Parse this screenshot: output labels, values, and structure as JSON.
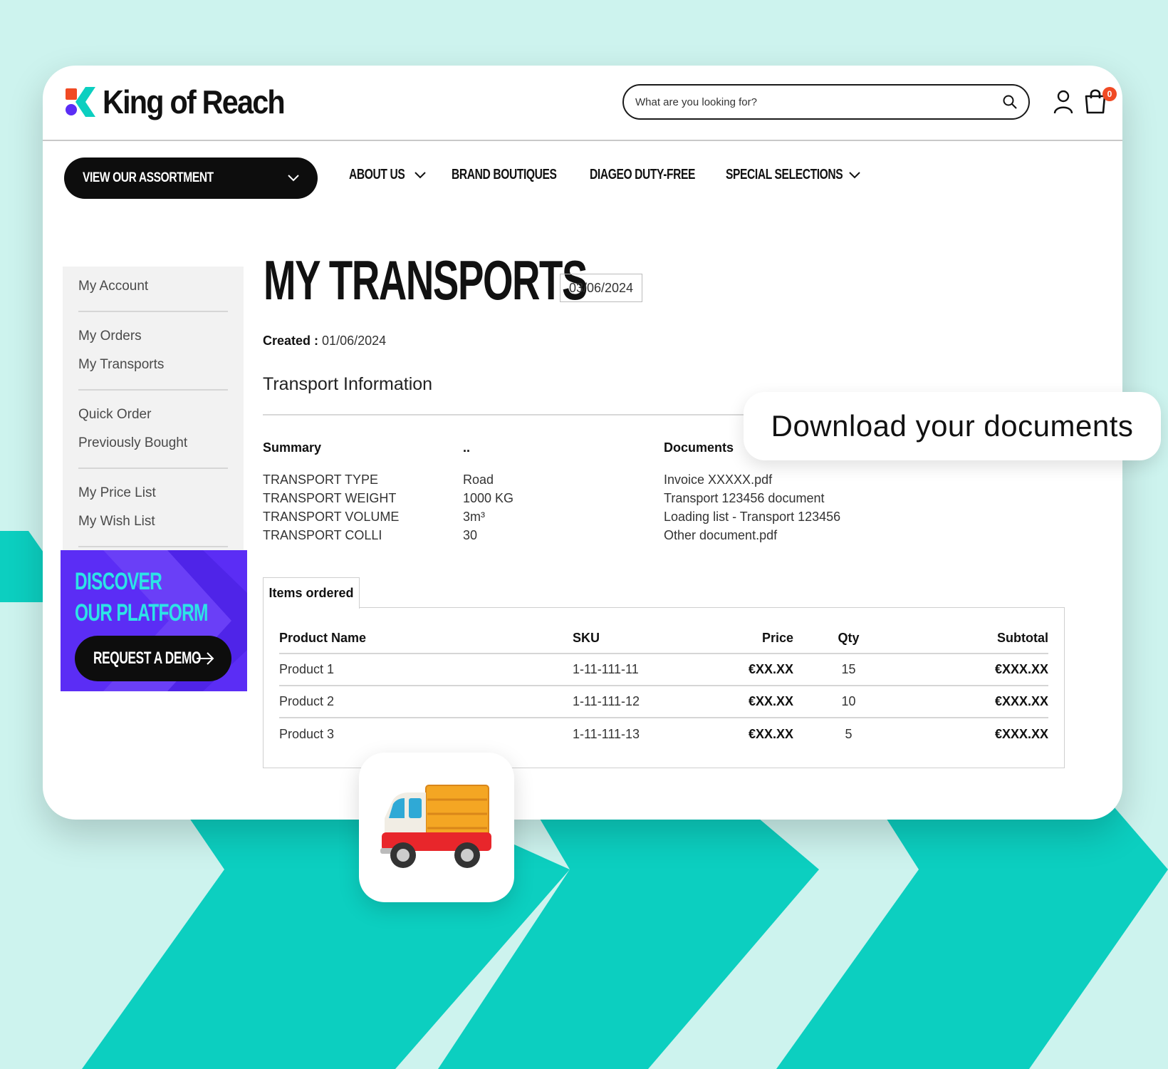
{
  "brand": {
    "name": "King of Reach",
    "colors": {
      "accent_teal": "#0ccfc0",
      "accent_purple": "#5b2df5",
      "accent_orange": "#f04a24",
      "dark": "#0d0d0d"
    }
  },
  "header": {
    "search_placeholder": "What are you looking for?",
    "icons": [
      "search-icon",
      "user-icon",
      "cart-icon"
    ],
    "cart_count": "0"
  },
  "nav": {
    "assortment_label": "VIEW OUR ASSORTMENT",
    "items": [
      {
        "label": "ABOUT US",
        "dropdown": true
      },
      {
        "label": "BRAND BOUTIQUES",
        "dropdown": false
      },
      {
        "label": "DIAGEO DUTY-FREE",
        "dropdown": false
      },
      {
        "label": "SPECIAL SELECTIONS",
        "dropdown": true
      }
    ]
  },
  "sidebar": {
    "groups": [
      [
        "My Account"
      ],
      [
        "My Orders",
        "My Transports"
      ],
      [
        "Quick Order",
        "Previously Bought"
      ],
      [
        "My Price List",
        "My Wish List"
      ]
    ],
    "promo": {
      "line1": "DISCOVER",
      "line2": "OUR PLATFORM",
      "button": "REQUEST A DEMO"
    }
  },
  "page": {
    "title": "MY TRANSPORTS",
    "date": "03/06/2024",
    "created_label": "Created :",
    "created_value": "01/06/2024",
    "section_title": "Transport Information"
  },
  "summary": {
    "heading": "Summary",
    "value_heading": "..",
    "rows": [
      {
        "label": "TRANSPORT TYPE",
        "value": "Road"
      },
      {
        "label": "TRANSPORT WEIGHT",
        "value": "1000 KG"
      },
      {
        "label": "TRANSPORT VOLUME",
        "value": "3m³"
      },
      {
        "label": "TRANSPORT COLLI",
        "value": "30"
      }
    ]
  },
  "documents": {
    "heading": "Documents",
    "items": [
      "Invoice XXXXX.pdf",
      "Transport 123456 document",
      "Loading list - Transport 123456",
      "Other document.pdf"
    ]
  },
  "items_ordered": {
    "tab_label": "Items ordered",
    "columns": [
      "Product Name",
      "SKU",
      "Price",
      "Qty",
      "Subtotal"
    ],
    "rows": [
      [
        "Product 1",
        "1-11-111-11",
        "€XX.XX",
        "15",
        "€XXX.XX"
      ],
      [
        "Product 2",
        "1-11-111-12",
        "€XX.XX",
        "10",
        "€XXX.XX"
      ],
      [
        "Product 3",
        "1-11-111-13",
        "€XX.XX",
        "5",
        "€XXX.XX"
      ]
    ]
  },
  "callout": {
    "text": "Download your documents"
  },
  "overlay_icon": "delivery-truck-icon"
}
